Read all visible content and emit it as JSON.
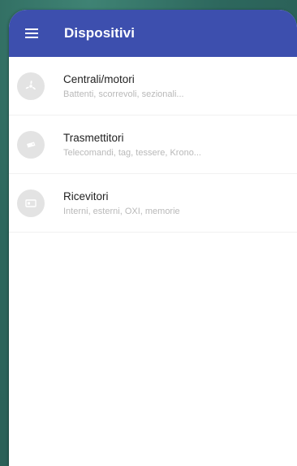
{
  "app": {
    "title": "Dispositivi",
    "menu_icon": "hamburger-menu-icon"
  },
  "colors": {
    "appbar": "#3d4fae",
    "background": "#2f6b61",
    "avatar": "#e3e3e3",
    "title_text": "#222222",
    "subtitle_text": "#b9b9b9"
  },
  "list": {
    "items": [
      {
        "title": "Centrali/motori",
        "subtitle": "Battenti, scorrevoli, sezionali...",
        "icon": "fan-icon"
      },
      {
        "title": "Trasmettitori",
        "subtitle": "Telecomandi, tag, tessere, Krono...",
        "icon": "remote-control-icon"
      },
      {
        "title": "Ricevitori",
        "subtitle": "Interni, esterni, OXI, memorie",
        "icon": "receiver-icon"
      }
    ]
  }
}
